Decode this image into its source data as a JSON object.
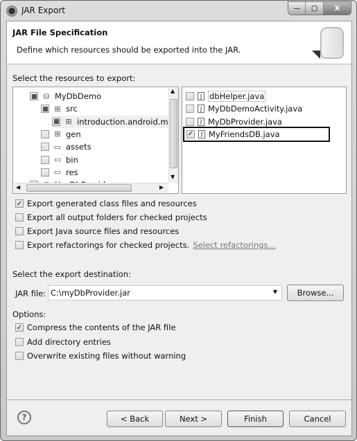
{
  "window": {
    "title": "JAR Export",
    "controls": {
      "minimize": "—",
      "maximize": "▢",
      "close": "X"
    }
  },
  "header": {
    "title": "JAR File Specification",
    "description": "Define which resources should be exported into the JAR."
  },
  "resources": {
    "label": "Select the resources to export:",
    "tree": [
      {
        "label": "MyDbDemo",
        "state": "partial",
        "icon": "project-icon"
      },
      {
        "label": "src",
        "state": "partial",
        "icon": "source-folder-icon"
      },
      {
        "label": "introduction.android.my",
        "state": "partial",
        "icon": "package-icon"
      },
      {
        "label": "gen",
        "state": "unchecked",
        "icon": "source-folder-icon"
      },
      {
        "label": "assets",
        "state": "unchecked",
        "icon": "folder-icon"
      },
      {
        "label": "bin",
        "state": "unchecked",
        "icon": "folder-icon"
      },
      {
        "label": "res",
        "state": "unchecked",
        "icon": "folder-icon"
      },
      {
        "label": "UseDbProvider",
        "state": "unchecked",
        "icon": "project-icon"
      }
    ],
    "files": [
      {
        "label": "dbHelper.java",
        "checked": false
      },
      {
        "label": "MyDbDemoActivity.java",
        "checked": false
      },
      {
        "label": "MyDbProvider.java",
        "checked": false
      },
      {
        "label": "MyFriendsDB.java",
        "checked": true
      }
    ]
  },
  "export_options": [
    {
      "label": "Export generated class files and resources",
      "checked": true
    },
    {
      "label": "Export all output folders for checked projects",
      "checked": false
    },
    {
      "label": "Export Java source files and resources",
      "checked": false
    },
    {
      "label": "Export refactorings for checked projects.",
      "checked": false,
      "link": "Select refactorings..."
    }
  ],
  "destination": {
    "label": "Select the export destination:",
    "field_label": "JAR file:",
    "value": "C:\\myDbProvider.jar",
    "browse": "Browse..."
  },
  "options": {
    "label": "Options:",
    "items": [
      {
        "label": "Compress the contents of the JAR file",
        "checked": true
      },
      {
        "label": "Add directory entries",
        "checked": false
      },
      {
        "label": "Overwrite existing files without warning",
        "checked": false
      }
    ]
  },
  "buttons": {
    "help": "?",
    "back": "< Back",
    "next": "Next >",
    "finish": "Finish",
    "cancel": "Cancel"
  }
}
